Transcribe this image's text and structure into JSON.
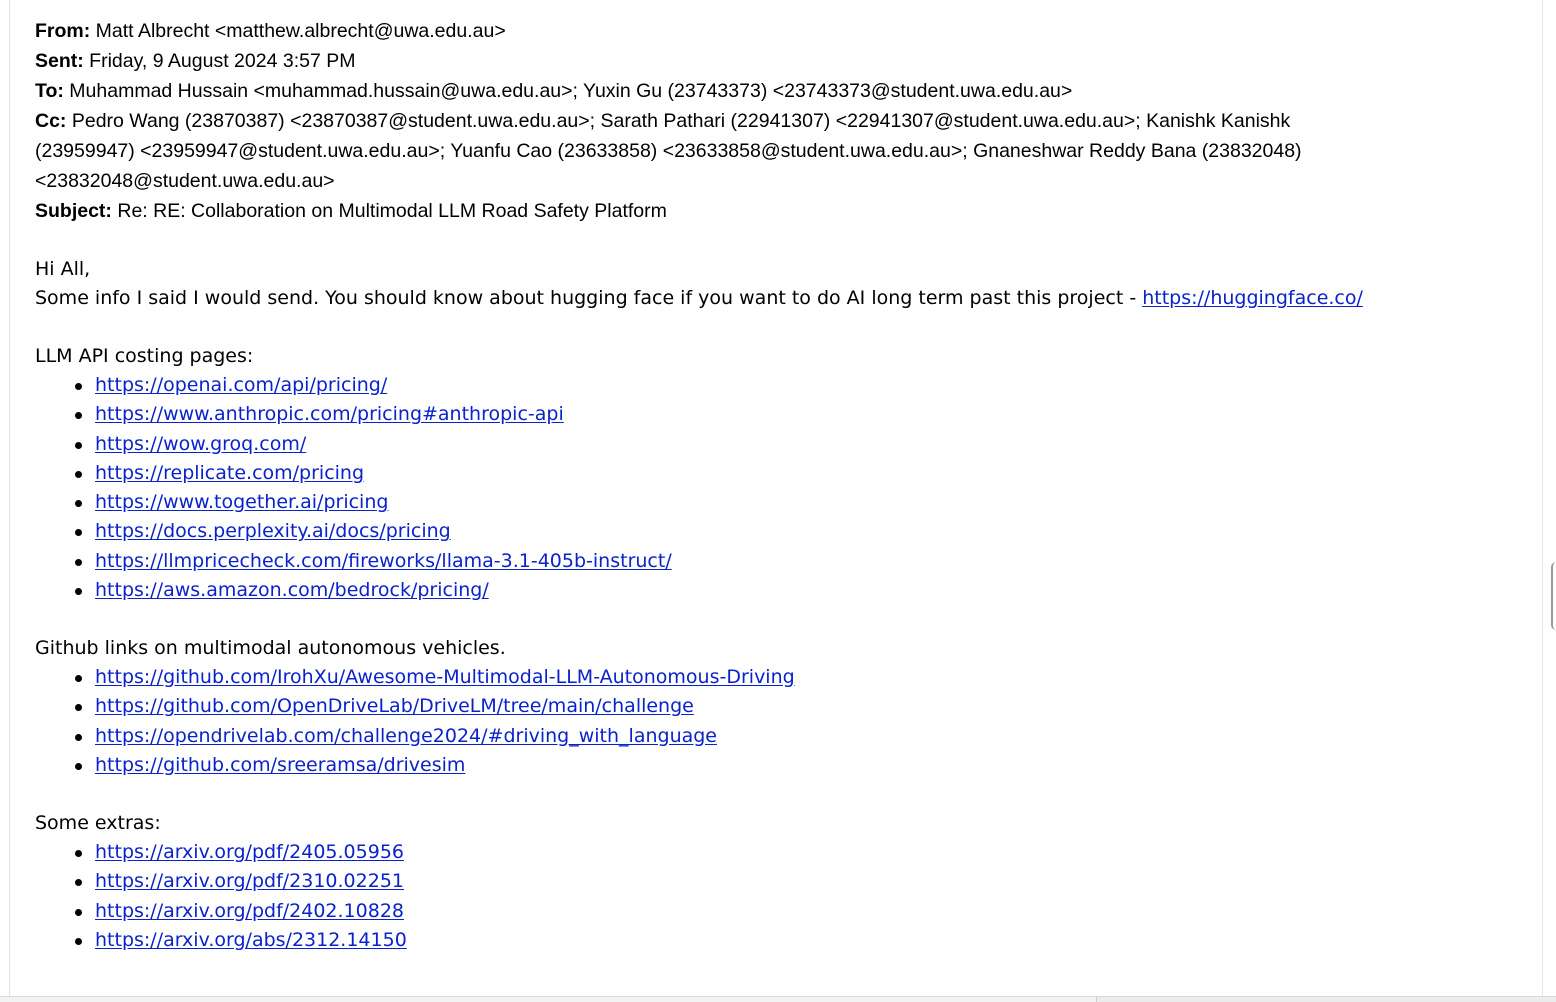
{
  "email": {
    "from": {
      "label": "From:",
      "value": "Matt Albrecht <matthew.albrecht@uwa.edu.au>"
    },
    "sent": {
      "label": "Sent:",
      "value": "Friday, 9 August 2024 3:57 PM"
    },
    "to": {
      "label": "To:",
      "value": "Muhammad Hussain <muhammad.hussain@uwa.edu.au>; Yuxin Gu (23743373) <23743373@student.uwa.edu.au>"
    },
    "cc": {
      "label": "Cc:",
      "line1": "Pedro Wang (23870387) <23870387@student.uwa.edu.au>; Sarath Pathari (22941307) <22941307@student.uwa.edu.au>; Kanishk Kanishk",
      "line2": "(23959947) <23959947@student.uwa.edu.au>; Yuanfu Cao (23633858) <23633858@student.uwa.edu.au>; Gnaneshwar Reddy Bana (23832048)",
      "line3": "<23832048@student.uwa.edu.au>"
    },
    "subject": {
      "label": "Subject:",
      "value": "Re: RE: Collaboration on Multimodal LLM Road Safety Platform"
    }
  },
  "body": {
    "greeting": "Hi All,",
    "intro": "Some info I said I would send. You should know about hugging face if you want to do AI long term past this project - ",
    "intro_link": "https://huggingface.co/",
    "sections": [
      {
        "heading": "LLM API costing pages:",
        "links": [
          "https://openai.com/api/pricing/",
          "https://www.anthropic.com/pricing#anthropic-api",
          "https://wow.groq.com/",
          "https://replicate.com/pricing",
          "https://www.together.ai/pricing",
          "https://docs.perplexity.ai/docs/pricing",
          "https://llmpricecheck.com/fireworks/llama-3.1-405b-instruct/",
          "https://aws.amazon.com/bedrock/pricing/"
        ]
      },
      {
        "heading": "Github links on multimodal autonomous vehicles.",
        "links": [
          "https://github.com/IrohXu/Awesome-Multimodal-LLM-Autonomous-Driving",
          "https://github.com/OpenDriveLab/DriveLM/tree/main/challenge",
          "https://opendrivelab.com/challenge2024/#driving_with_language",
          "https://github.com/sreeramsa/drivesim"
        ]
      },
      {
        "heading": "Some extras:",
        "links": [
          "https://arxiv.org/pdf/2405.05956",
          "https://arxiv.org/pdf/2310.02251",
          "https://arxiv.org/pdf/2402.10828",
          "https://arxiv.org/abs/2312.14150"
        ]
      }
    ]
  },
  "colors": {
    "link": "#0a22cc",
    "text": "#000000",
    "background": "#ffffff"
  }
}
